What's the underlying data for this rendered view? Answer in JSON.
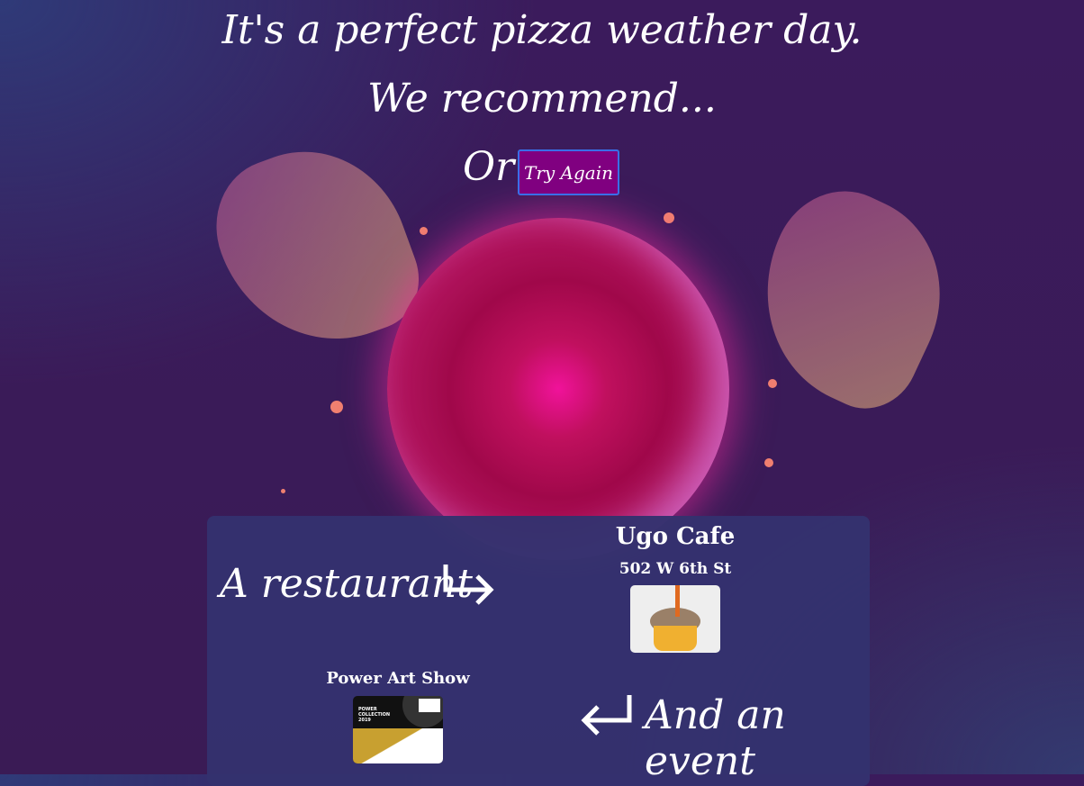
{
  "header": {
    "line1": "It's a perfect pizza weather day.",
    "line2": "We recommend...",
    "or_label": "Or",
    "try_again_label": "Try Again"
  },
  "results": {
    "restaurant_label": "A restaurant",
    "event_label": "And an event",
    "restaurant": {
      "name": "Ugo Cafe",
      "address": "502 W 6th St"
    },
    "event": {
      "name": "Power Art Show",
      "poster_text": "POWER COLLECTION 2019"
    }
  },
  "colors": {
    "button": "#800080",
    "panel": "#34326e",
    "ball": "#c0105e"
  }
}
